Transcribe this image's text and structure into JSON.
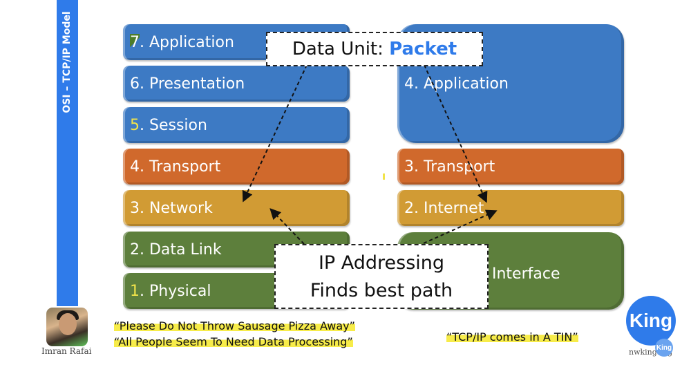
{
  "sidebar": {
    "title": "OSI – TCP/IP Model",
    "color": "#2f7bea"
  },
  "osi_layers": [
    {
      "num": "7",
      "label": ". Application",
      "color": "#3d7ac4",
      "num_highlight": "#4c7d2a"
    },
    {
      "num": "6",
      "label": ". Presentation",
      "color": "#3d7ac4"
    },
    {
      "num": "5",
      "label": ". Session",
      "color": "#3d7ac4",
      "num_highlight": "#e8d93a"
    },
    {
      "num": "4",
      "label": ". Transport",
      "color": "#d0692c"
    },
    {
      "num": "3",
      "label": ". Network",
      "color": "#d19b34"
    },
    {
      "num": "2",
      "label": ". Data Link",
      "color": "#5d7f3c"
    },
    {
      "num": "1",
      "label": ". Physical",
      "color": "#5d7f3c",
      "num_highlight": "#e8d93a"
    }
  ],
  "tcpip_layers": [
    {
      "label": "4. Application",
      "color": "#3d7ac4"
    },
    {
      "label": "3. Transport",
      "color": "#d0692c"
    },
    {
      "label": "2. Internet",
      "color": "#d19b34"
    },
    {
      "label": "Interface",
      "color": "#5d7f3c"
    }
  ],
  "callouts": {
    "data_unit": {
      "prefix": "Data Unit: ",
      "value": "Packet",
      "value_color": "#2f7bea"
    },
    "function": {
      "line1": "IP Addressing",
      "line2": "Finds best path"
    }
  },
  "presenter": {
    "name": "Imran Rafai"
  },
  "mnemonics": {
    "osi_top_down": "“Please Do Not Throw Sausage Pizza Away”",
    "osi_bottom_up": "“All People Seem To Need Data Processing”",
    "tcpip": "“TCP/IP comes in A TIN”",
    "highlight_color": "#f7ec4a"
  },
  "logo": {
    "text": "King",
    "small_text": "King",
    "site": "nwking.org",
    "color": "#2f7bea"
  }
}
